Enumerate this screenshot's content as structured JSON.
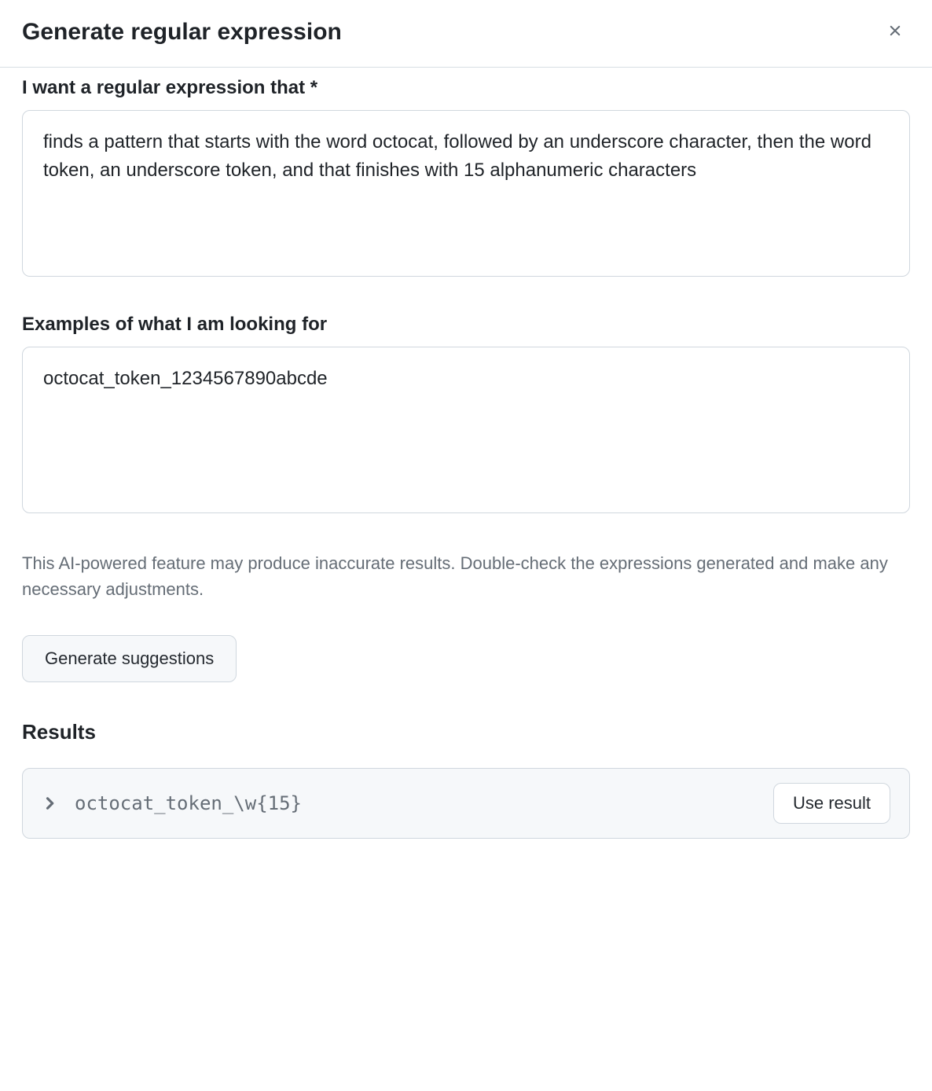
{
  "dialog": {
    "title": "Generate regular expression"
  },
  "fields": {
    "description": {
      "label": "I want a regular expression that *",
      "value": "finds a pattern that starts with the word octocat, followed by an underscore character, then the word token, an underscore token, and that finishes with 15 alphanumeric characters"
    },
    "examples": {
      "label": "Examples of what I am looking for",
      "value": "octocat_token_1234567890abcde"
    }
  },
  "disclaimer": "This AI-powered feature may produce inaccurate results. Double-check the expressions generated and make any necessary adjustments.",
  "buttons": {
    "generate": "Generate suggestions",
    "use_result": "Use result"
  },
  "results": {
    "heading": "Results",
    "items": [
      {
        "pattern": "octocat_token_\\w{15}"
      }
    ]
  }
}
